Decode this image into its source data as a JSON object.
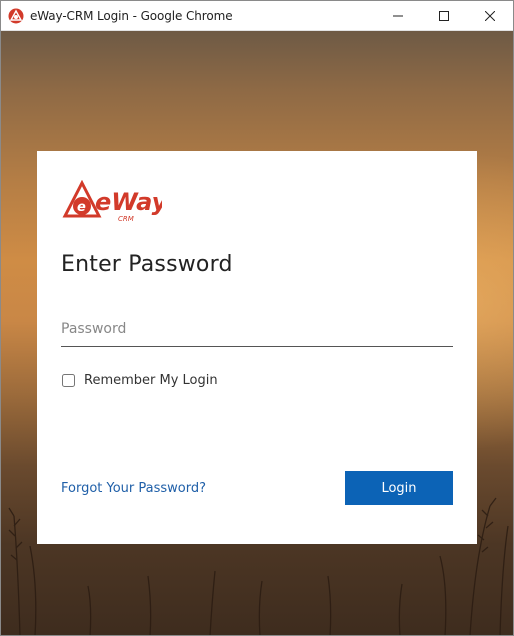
{
  "window": {
    "title": "eWay-CRM Login - Google Chrome",
    "icon": "eway-app-icon",
    "controls": [
      "minimize-icon",
      "maximize-icon",
      "close-icon"
    ]
  },
  "brand": {
    "logo_text": "eWay",
    "logo_subtext": "CRM",
    "accent_color": "#d23a2a"
  },
  "login": {
    "heading": "Enter Password",
    "password_placeholder": "Password",
    "password_value": "",
    "remember_label": "Remember My Login",
    "remember_checked": false,
    "forgot_link": "Forgot Your Password?",
    "login_button": "Login",
    "button_color": "#0c63b6"
  }
}
